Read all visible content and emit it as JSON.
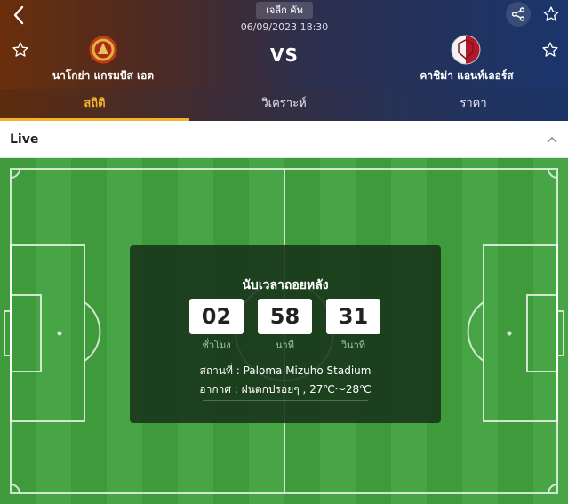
{
  "header": {
    "league": "เจลีก คัพ",
    "datetime": "06/09/2023 18:30",
    "vs": "VS",
    "home_team": "นาโกย่า แกรมปัส เอต",
    "away_team": "คาชิม่า แอนท์เลอร์ส",
    "icons": [
      "back-arrow-icon",
      "share-icon",
      "star-icon"
    ]
  },
  "tabs": [
    {
      "label": "สถิติ",
      "active": true
    },
    {
      "label": "วิเคราะห์",
      "active": false
    },
    {
      "label": "ราคา",
      "active": false
    }
  ],
  "live": {
    "label": "Live"
  },
  "countdown": {
    "title": "นับเวลาถอยหลัง",
    "hours": "02",
    "minutes": "58",
    "seconds": "31",
    "hours_label": "ชั่วโมง",
    "minutes_label": "นาที",
    "seconds_label": "วินาที",
    "venue_line": "สถานที่ : Paloma Mizuho Stadium",
    "weather_line": "อากาศ : ฝนตกปรอยๆ , 27℃～28℃"
  },
  "colors": {
    "accent": "#f5b32b",
    "pitch": "#48a545",
    "panel": "#163018"
  }
}
